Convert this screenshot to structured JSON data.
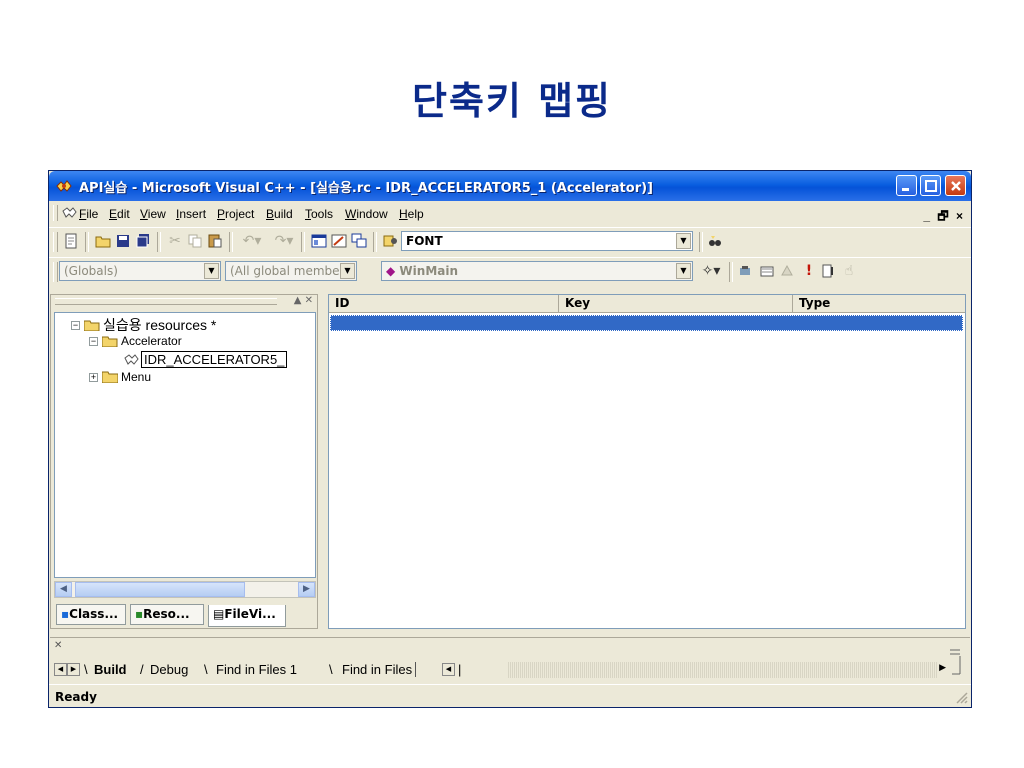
{
  "slide": {
    "title": "단축키 맵핑"
  },
  "window": {
    "title": "API실습 - Microsoft Visual C++ - [실습용.rc - IDR_ACCELERATOR5_1 (Accelerator)]",
    "menu": [
      "File",
      "Edit",
      "View",
      "Insert",
      "Project",
      "Build",
      "Tools",
      "Window",
      "Help"
    ],
    "menu_mnemonics": [
      "F",
      "E",
      "V",
      "I",
      "P",
      "B",
      "T",
      "W",
      "H"
    ],
    "mdi_controls": "_ 🗗 ×",
    "toolbar": {
      "find_combo_value": "FONT"
    },
    "wizardbar": {
      "class_combo": "(Globals)",
      "members_combo": "(All global members",
      "function_combo": "WinMain"
    }
  },
  "workspace": {
    "root": "실습용 resources *",
    "nodes": [
      {
        "label": "Accelerator"
      },
      {
        "label": "IDR_ACCELERATOR5_"
      },
      {
        "label": "Menu"
      }
    ],
    "tabs": [
      "Class...",
      "Reso...",
      "FileVi..."
    ]
  },
  "accelerator_table": {
    "columns": [
      "ID",
      "Key",
      "Type"
    ],
    "rows": [
      {
        "id": "",
        "key": "",
        "type": ""
      }
    ]
  },
  "output": {
    "tabs": [
      "Build",
      "Debug",
      "Find in Files 1",
      "Find in Files"
    ]
  },
  "statusbar": {
    "text": "Ready"
  },
  "colors": {
    "titlebar": "#0a5fe0",
    "slide_title": "#0b2a8a",
    "selection": "#3169c6"
  }
}
